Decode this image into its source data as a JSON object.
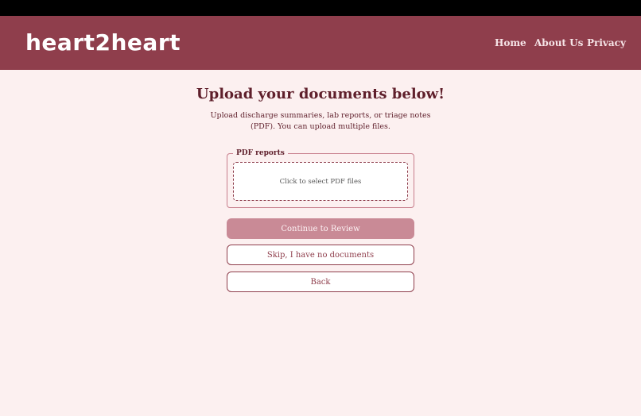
{
  "app": {
    "logo": "heart2heart"
  },
  "nav": {
    "home": "Home",
    "about": "About Us",
    "privacy": "Privacy"
  },
  "main": {
    "title": "Upload your documents below!",
    "subtitle": "Upload discharge summaries, lab reports, or triage notes (PDF). You can upload multiple files.",
    "fieldset_legend": "PDF reports",
    "dropzone_text": "Click to select PDF files",
    "continue_label": "Continue to Review",
    "skip_label": "Skip, I have no documents",
    "back_label": "Back"
  },
  "colors": {
    "header": "#8f3e4c",
    "background": "#fcf0f0",
    "primary_button": "#c98a96",
    "text_dark": "#5f1f2b"
  }
}
